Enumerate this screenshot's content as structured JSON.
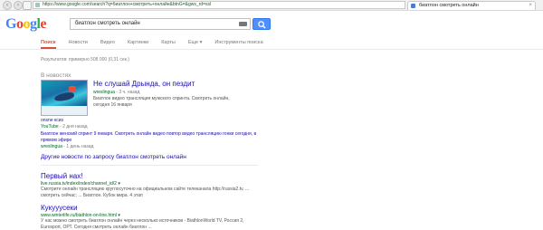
{
  "browser": {
    "address": "https://www.google.com/search?q=биатлон+смотреть+онлайн&btnG=&gws_rd=ssl",
    "tab_title": "биатлон смотреть онлайн",
    "tab_close": "×",
    "back": "‹",
    "forward": "›"
  },
  "logo": {
    "letters": [
      "G",
      "o",
      "o",
      "g",
      "l",
      "e"
    ],
    "colors": [
      "#4285f4",
      "#ea4335",
      "#fbbc05",
      "#4285f4",
      "#34a853",
      "#ea4335"
    ]
  },
  "search": {
    "query": "биатлон смотреть онлайн"
  },
  "tabs": [
    {
      "label": "Поиск",
      "active": true
    },
    {
      "label": "Новости",
      "active": false
    },
    {
      "label": "Видео",
      "active": false
    },
    {
      "label": "Картинки",
      "active": false
    },
    {
      "label": "Карты",
      "active": false
    },
    {
      "label": "Еще ▾",
      "active": false
    },
    {
      "label": "Инструменты поиска",
      "active": false
    }
  ],
  "stats": "Результатов: примерно 508 000 (0,31 сек.)",
  "news": {
    "header": "В новостях",
    "item1": {
      "title": "Не слушай Дрында, он пездит",
      "source": "wreslingua",
      "time": " - 3 ч. назад",
      "desc": "Биатлон видео трансляция мужского спринта. Смотреть онлайн, сегодня 16 января"
    },
    "item2": {
      "title": "onsne ксиз",
      "source": "YouTube",
      "time": " - 2 дня назад"
    },
    "item3": {
      "title": "Биатлон женский спринт 9 января. Смотреть онлайн видео повтор видео трансляцию гонки сегодня, в прямом эфире",
      "source": "wreslingua",
      "time": " - 1 день назад"
    },
    "more": "Другие новости по запросу биатлон смотреть онлайн"
  },
  "results": [
    {
      "title": "Первый нах!",
      "url": "live.russia.tv/index/index/channel_id/2 ▾",
      "desc": "Смотрите онлайн трансляцию круглосуточно на официальном сайте телеканала http://russia2.tv. ... смотреть сейчас; ... Биатлон. Кубок мира. 4 этап"
    },
    {
      "title": "Кукууусеки",
      "url": "www.winterlife.ru/biathlon-on-line.html ▾",
      "desc": "У нас можно смотреть биатлон онлайн через несколько источников - BiathlonWorld TV, Россия 2, Eurosport, ОРТ. Сегодня смотреть онлайн биатлон ..."
    }
  ]
}
